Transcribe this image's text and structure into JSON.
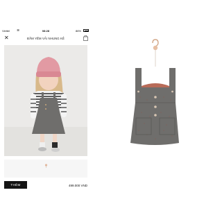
{
  "status_bar": {
    "carrier": "Viettel",
    "time": "08:28",
    "battery": "86%"
  },
  "nav": {
    "title": "ĐẦM YẾM VẢI NHUNG KẺ"
  },
  "actions": {
    "add_label": "THÊM",
    "price": "499.000 VND"
  },
  "icons": [
    "wifi-icon",
    "battery-icon",
    "close-icon",
    "bag-icon",
    "hanger-icon"
  ],
  "colors": {
    "dress": "#6f6e6c",
    "beanie": "#e29aa3",
    "button_bg": "#141414"
  }
}
